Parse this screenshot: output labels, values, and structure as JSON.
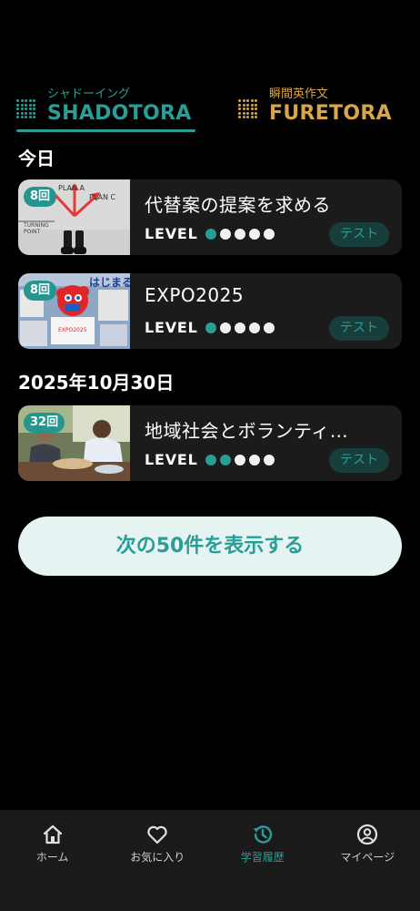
{
  "tabs": [
    {
      "sub": "シャドーイング",
      "main": "SHADOTORA",
      "active": true,
      "color": "#2a9d97"
    },
    {
      "sub": "瞬間英作文",
      "main": "FURETORA",
      "active": false,
      "color": "#d7a54a"
    }
  ],
  "sections": [
    {
      "heading": "今日",
      "items": [
        {
          "badge": "8回",
          "title": "代替案の提案を求める",
          "level_label": "LEVEL",
          "level": 1,
          "level_max": 5,
          "test_label": "テスト"
        },
        {
          "badge": "8回",
          "title": "EXPO2025",
          "level_label": "LEVEL",
          "level": 1,
          "level_max": 5,
          "test_label": "テスト"
        }
      ]
    },
    {
      "heading": "2025年10月30日",
      "items": [
        {
          "badge": "32回",
          "title": "地域社会とボランティ…",
          "level_label": "LEVEL",
          "level": 2,
          "level_max": 5,
          "test_label": "テスト"
        }
      ]
    }
  ],
  "thumb_texts": {
    "plan_a": "PLAN A",
    "plan_c": "PLAN C",
    "turning": "TURNING",
    "point": "POINT",
    "hajimaru": "はじまる"
  },
  "load_more_label": "次の50件を表示する",
  "bottom_nav": [
    {
      "label": "ホーム",
      "icon": "home-icon",
      "active": false
    },
    {
      "label": "お気に入り",
      "icon": "heart-icon",
      "active": false
    },
    {
      "label": "学習履歴",
      "icon": "history-icon",
      "active": true
    },
    {
      "label": "マイページ",
      "icon": "user-icon",
      "active": false
    }
  ],
  "colors": {
    "accent": "#2a9d97",
    "gold": "#d7a54a",
    "card": "#1b1b1b",
    "background": "#000000"
  }
}
